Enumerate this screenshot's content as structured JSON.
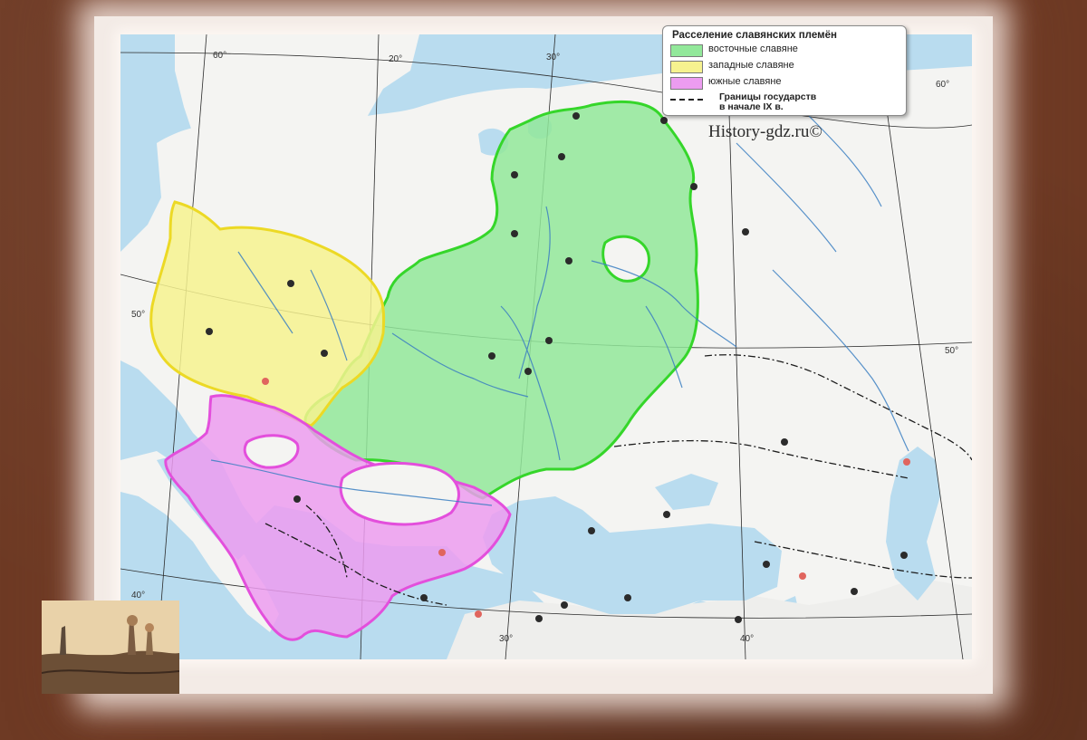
{
  "legend": {
    "title": "Расселение славянских племён",
    "items": [
      {
        "label": "восточные славяне",
        "color": "#92e89a"
      },
      {
        "label": "западные славяне",
        "color": "#f6f28f"
      },
      {
        "label": "южные славяне",
        "color": "#ec9cf0"
      }
    ],
    "border_label_line1": "Границы государств",
    "border_label_line2": "в начале IX в."
  },
  "watermark": "History-gdz.ru©",
  "map": {
    "colors": {
      "sea": "#b9dcef",
      "land": "#f5f5f5",
      "east": "#92e89a",
      "west": "#f6f28f",
      "south": "#ec9cf0",
      "river": "#3b7fc2"
    },
    "graticule": {
      "lon": [
        "20°",
        "30°",
        "40°",
        "60°",
        "60°"
      ],
      "lat": [
        "50°",
        "50°",
        "40°"
      ],
      "lon_bottom": [
        "30°",
        "40°"
      ]
    }
  }
}
